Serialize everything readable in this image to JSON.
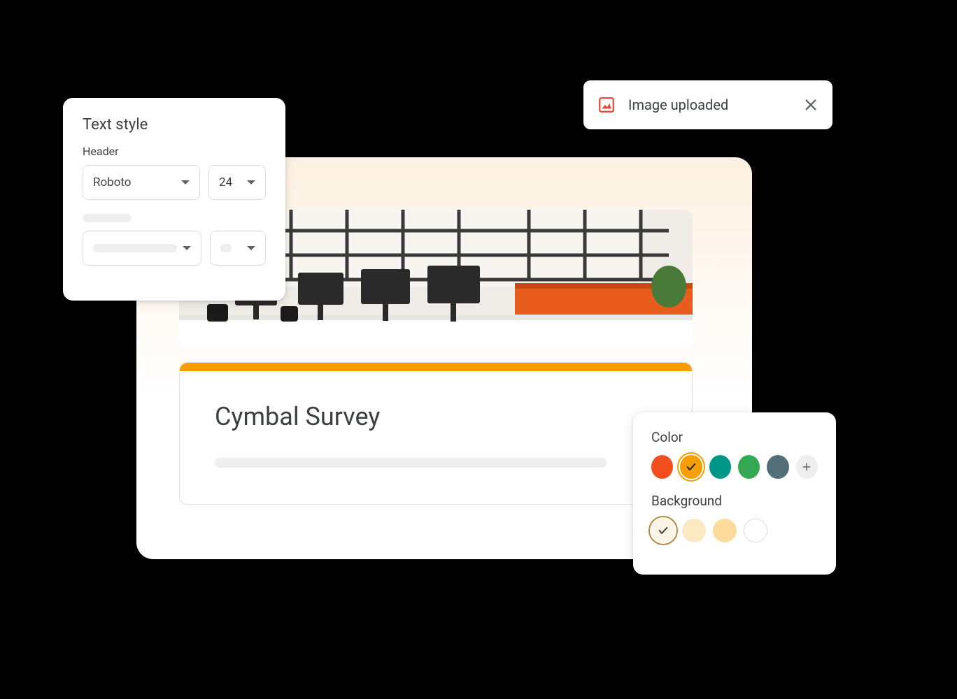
{
  "text_style": {
    "title": "Text style",
    "header_label": "Header",
    "font": "Roboto",
    "size": "24"
  },
  "toast": {
    "message": "Image uploaded"
  },
  "survey": {
    "title": "Cymbal Survey"
  },
  "color_panel": {
    "color_label": "Color",
    "background_label": "Background",
    "colors": [
      {
        "hex": "#f24e1e",
        "selected": false
      },
      {
        "hex": "#f59e00",
        "selected": true
      },
      {
        "hex": "#009688",
        "selected": false
      },
      {
        "hex": "#34a853",
        "selected": false
      },
      {
        "hex": "#546e7a",
        "selected": false
      }
    ],
    "backgrounds": [
      {
        "hex": "#fdf3e4",
        "selected": true
      },
      {
        "hex": "#fde8c4",
        "selected": false
      },
      {
        "hex": "#fddb9c",
        "selected": false
      },
      {
        "hex": "#ffffff",
        "selected": false
      }
    ]
  },
  "accent": "#f59e00"
}
